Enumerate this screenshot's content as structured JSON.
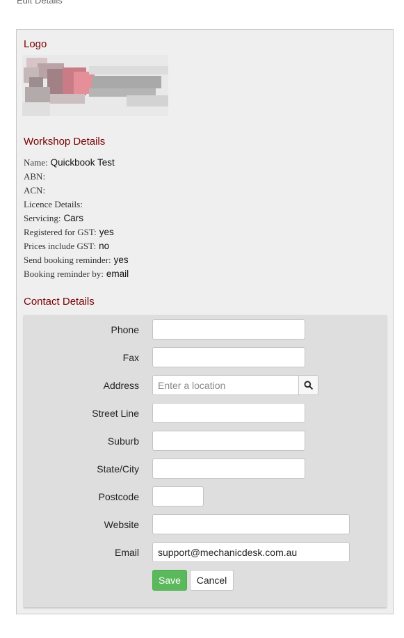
{
  "top_cut_text": "Edit Details",
  "logo": {
    "title": "Logo"
  },
  "workshop": {
    "title": "Workshop Details",
    "rows": [
      {
        "label": "Name:",
        "value": "Quickbook Test"
      },
      {
        "label": "ABN:",
        "value": ""
      },
      {
        "label": "ACN:",
        "value": ""
      },
      {
        "label": "Licence Details:",
        "value": ""
      },
      {
        "label": "Servicing:",
        "value": "Cars"
      },
      {
        "label": "Registered for GST:",
        "value": "yes"
      },
      {
        "label": "Prices include GST:",
        "value": "no"
      },
      {
        "label": "Send booking reminder:",
        "value": "yes"
      },
      {
        "label": "Booking reminder by:",
        "value": "email"
      }
    ]
  },
  "contact": {
    "title": "Contact Details",
    "phone": {
      "label": "Phone",
      "value": ""
    },
    "fax": {
      "label": "Fax",
      "value": ""
    },
    "address": {
      "label": "Address",
      "value": "",
      "placeholder": "Enter a location",
      "icon": "search-icon"
    },
    "street": {
      "label": "Street Line",
      "value": ""
    },
    "suburb": {
      "label": "Suburb",
      "value": ""
    },
    "state": {
      "label": "State/City",
      "value": ""
    },
    "postcode": {
      "label": "Postcode",
      "value": ""
    },
    "website": {
      "label": "Website",
      "value": ""
    },
    "email": {
      "label": "Email",
      "value": "support@mechanicdesk.com.au"
    },
    "save_label": "Save",
    "cancel_label": "Cancel"
  },
  "colors": {
    "heading": "#7a0000",
    "save": "#5cb85c",
    "panel": "#efefef",
    "form_bg": "#dedede"
  }
}
